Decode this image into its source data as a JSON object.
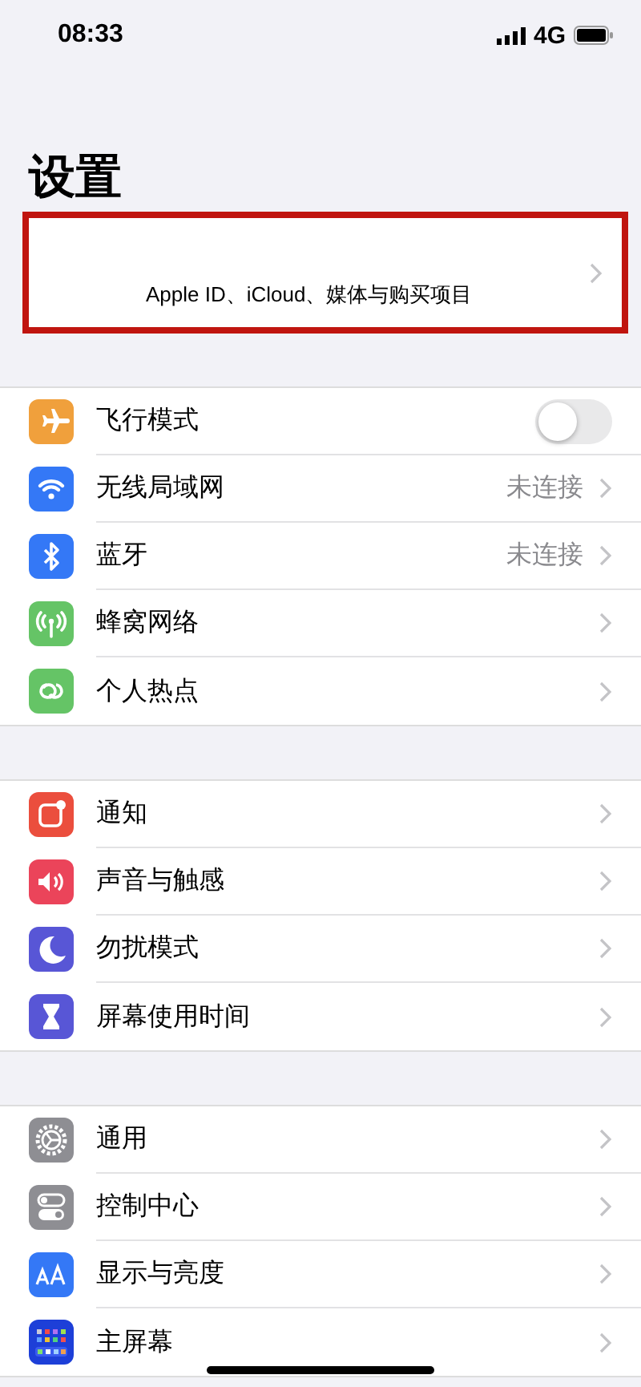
{
  "status_bar": {
    "time": "08:33",
    "network": "4G"
  },
  "title": "设置",
  "profile": {
    "subtitle": "Apple ID、iCloud、媒体与购买项目",
    "highlighted": true
  },
  "groups": [
    {
      "items": [
        {
          "label": "飞行模式",
          "kind": "toggle",
          "on": false,
          "color": "#f0a03c"
        },
        {
          "label": "无线局域网",
          "kind": "link",
          "value": "未连接",
          "color": "#3478f6"
        },
        {
          "label": "蓝牙",
          "kind": "link",
          "value": "未连接",
          "color": "#3478f6"
        },
        {
          "label": "蜂窝网络",
          "kind": "link",
          "color": "#65c466"
        },
        {
          "label": "个人热点",
          "kind": "link",
          "color": "#65c466"
        }
      ]
    },
    {
      "items": [
        {
          "label": "通知",
          "kind": "link",
          "color": "#eb4e3d"
        },
        {
          "label": "声音与触感",
          "kind": "link",
          "color": "#eb445a"
        },
        {
          "label": "勿扰模式",
          "kind": "link",
          "color": "#5856d6"
        },
        {
          "label": "屏幕使用时间",
          "kind": "link",
          "color": "#5856d6"
        }
      ]
    },
    {
      "items": [
        {
          "label": "通用",
          "kind": "link",
          "color": "#8e8e93"
        },
        {
          "label": "控制中心",
          "kind": "link",
          "color": "#8e8e93"
        },
        {
          "label": "显示与亮度",
          "kind": "link",
          "color": "#3478f6"
        },
        {
          "label": "主屏幕",
          "kind": "link",
          "color": "#1d3fd8"
        }
      ]
    }
  ]
}
